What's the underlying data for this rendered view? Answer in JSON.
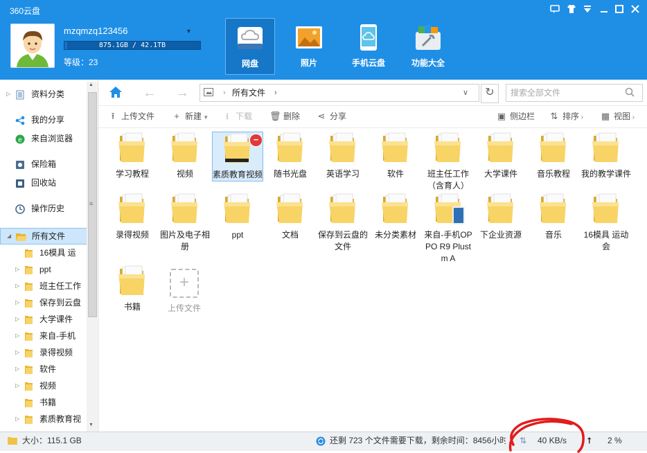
{
  "app": {
    "title": "360云盘"
  },
  "user": {
    "name": "mzqmzq123456",
    "quota_text": "875.1GB / 42.1TB",
    "quota_used_fraction": 0.02,
    "level": "等级：23"
  },
  "nav_tabs": [
    {
      "label": "网盘",
      "icon": "cloud-disk-icon",
      "active": true
    },
    {
      "label": "照片",
      "icon": "photo-icon",
      "active": false
    },
    {
      "label": "手机云盘",
      "icon": "phone-cloud-icon",
      "active": false
    },
    {
      "label": "功能大全",
      "icon": "toolbox-icon",
      "active": false
    }
  ],
  "sidebar": {
    "items": [
      {
        "label": "资料分类",
        "icon": "category-icon",
        "expandable": true
      },
      {
        "label": "我的分享",
        "icon": "share-icon"
      },
      {
        "label": "来自浏览器",
        "icon": "browser-icon"
      },
      {
        "label": "保险箱",
        "icon": "safe-icon"
      },
      {
        "label": "回收站",
        "icon": "recycle-bin-icon"
      },
      {
        "label": "操作历史",
        "icon": "history-icon"
      },
      {
        "label": "所有文件",
        "icon": "folder-open-icon",
        "selected": true
      }
    ],
    "folders": [
      "16模具 运",
      "ppt",
      "班主任工作",
      "保存到云盘",
      "大学课件",
      "来自-手机",
      "录得视频",
      "软件",
      "视频",
      "书籍",
      "素质教育视"
    ]
  },
  "navbar": {
    "path": "所有文件",
    "search_placeholder": "搜索全部文件"
  },
  "actions": {
    "upload": "上传文件",
    "new": "新建",
    "download": "下载",
    "delete": "删除",
    "share": "分享",
    "sidebar": "侧边栏",
    "sort": "排序",
    "view": "视图"
  },
  "files": [
    {
      "name": "学习教程"
    },
    {
      "name": "视频"
    },
    {
      "name": "素质教育视频",
      "selected": true
    },
    {
      "name": "随书光盘"
    },
    {
      "name": "英语学习"
    },
    {
      "name": "软件"
    },
    {
      "name": "班主任工作（含育人）"
    },
    {
      "name": "大学课件"
    },
    {
      "name": "音乐教程"
    },
    {
      "name": "我的教学课件"
    },
    {
      "name": "录得视频"
    },
    {
      "name": "图片及电子相册"
    },
    {
      "name": "ppt"
    },
    {
      "name": "文档"
    },
    {
      "name": "保存到云盘的文件"
    },
    {
      "name": "未分类素材"
    },
    {
      "name": "来自-手机OPPO R9 Plustm A",
      "badge": "phone"
    },
    {
      "name": "下企业资源"
    },
    {
      "name": "音乐"
    },
    {
      "name": "16模具 运动会"
    },
    {
      "name": "书籍"
    }
  ],
  "upload_tile": {
    "label": "上传文件"
  },
  "status": {
    "size": "大小：115.1 GB",
    "progress_text": "还剩 723 个文件需要下载，剩余时间：8456小时",
    "speed": "40 KB/s",
    "percent": "2 %"
  },
  "colors": {
    "header": "#1f8fe6",
    "accent": "#1677c9",
    "folder": "#f5cd5b",
    "annotation": "#e31b1b"
  }
}
